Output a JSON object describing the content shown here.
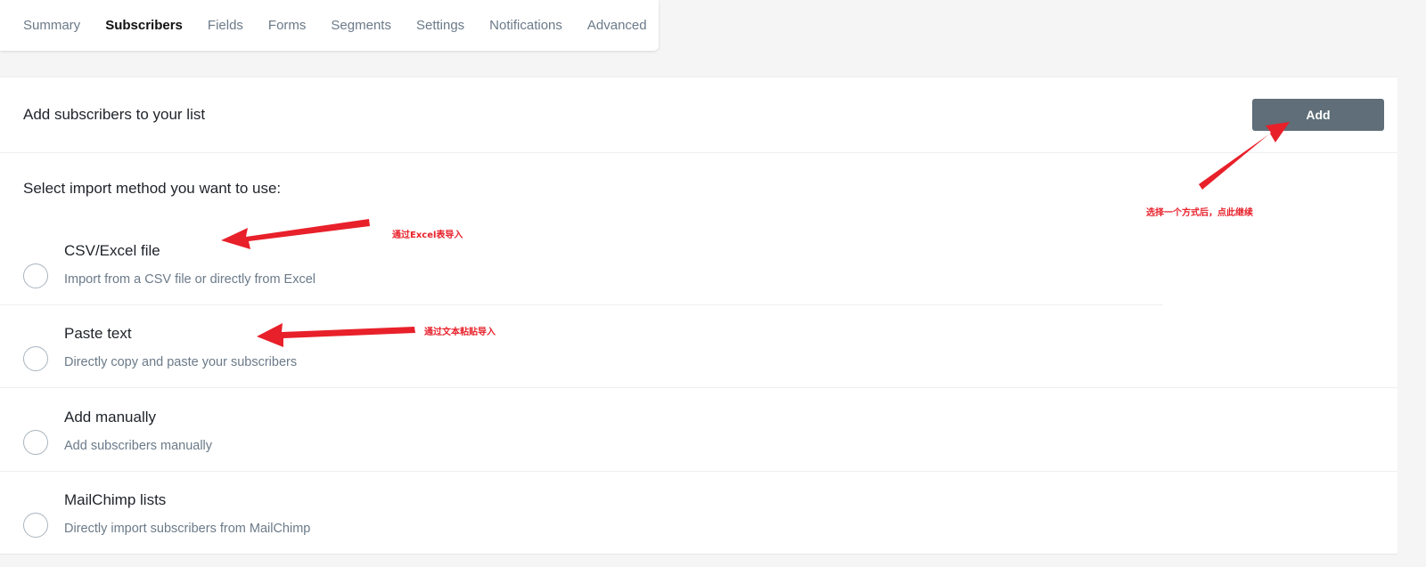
{
  "tabs": [
    {
      "label": "Summary",
      "active": false
    },
    {
      "label": "Subscribers",
      "active": true
    },
    {
      "label": "Fields",
      "active": false
    },
    {
      "label": "Forms",
      "active": false
    },
    {
      "label": "Segments",
      "active": false
    },
    {
      "label": "Settings",
      "active": false
    },
    {
      "label": "Notifications",
      "active": false
    },
    {
      "label": "Advanced",
      "active": false
    }
  ],
  "header": {
    "title": "Add subscribers to your list",
    "add_label": "Add"
  },
  "import": {
    "prompt": "Select import method you want to use:",
    "options": [
      {
        "title": "CSV/Excel file",
        "desc": "Import from a CSV file or directly from Excel",
        "selected": false
      },
      {
        "title": "Paste text",
        "desc": "Directly copy and paste your subscribers",
        "selected": false
      },
      {
        "title": "Add manually",
        "desc": "Add subscribers manually",
        "selected": false
      },
      {
        "title": "MailChimp lists",
        "desc": "Directly import subscribers from MailChimp",
        "selected": false
      }
    ]
  },
  "annotations": {
    "excel": "通过Excel表导入",
    "paste": "通过文本粘贴导入",
    "continue": "选择一个方式后，点此继续"
  },
  "colors": {
    "button_bg": "#5f6e78",
    "annotation_red": "#e8202a",
    "muted_text": "#6b7a89"
  }
}
